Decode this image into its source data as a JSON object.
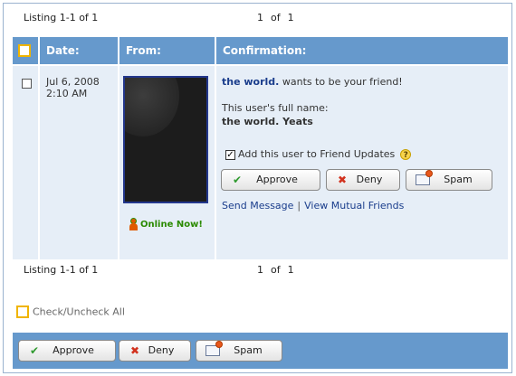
{
  "pagination_top": {
    "listing": "Listing 1-1 of 1",
    "current": "1",
    "of_label": "of",
    "total": "1"
  },
  "pagination_bottom": {
    "listing": "Listing 1-1 of 1",
    "current": "1",
    "of_label": "of",
    "total": "1"
  },
  "columns": {
    "date": "Date:",
    "from": "From:",
    "confirmation": "Confirmation:"
  },
  "request": {
    "date": "Jul 6, 2008",
    "time": "2:10 AM",
    "online_status": "Online Now!",
    "sender_name": "the world.",
    "message": " wants to be your friend!",
    "full_name_label": "This user's full name:",
    "full_name": "the world. Yeats",
    "friend_updates_label": "Add this user to Friend Updates",
    "friend_updates_checked": true,
    "help_glyph": "?",
    "approve_label": "Approve",
    "deny_label": "Deny",
    "spam_label": "Spam",
    "send_message_label": "Send Message",
    "separator": "|",
    "mutual_friends_label": "View Mutual Friends"
  },
  "check_all_label": "Check/Uncheck All",
  "footer": {
    "approve_label": "Approve",
    "deny_label": "Deny",
    "spam_label": "Spam"
  },
  "icons": {
    "approve": "checkmark-icon",
    "deny": "x-icon",
    "spam": "spam-mail-icon",
    "online": "online-person-icon",
    "help": "help-icon"
  },
  "colors": {
    "header_blue": "#6699cc",
    "row_bg": "#e6eef7",
    "link": "#1a3d8c",
    "online_green": "#2a8a00",
    "checkbox_yellow": "#f0b400"
  }
}
